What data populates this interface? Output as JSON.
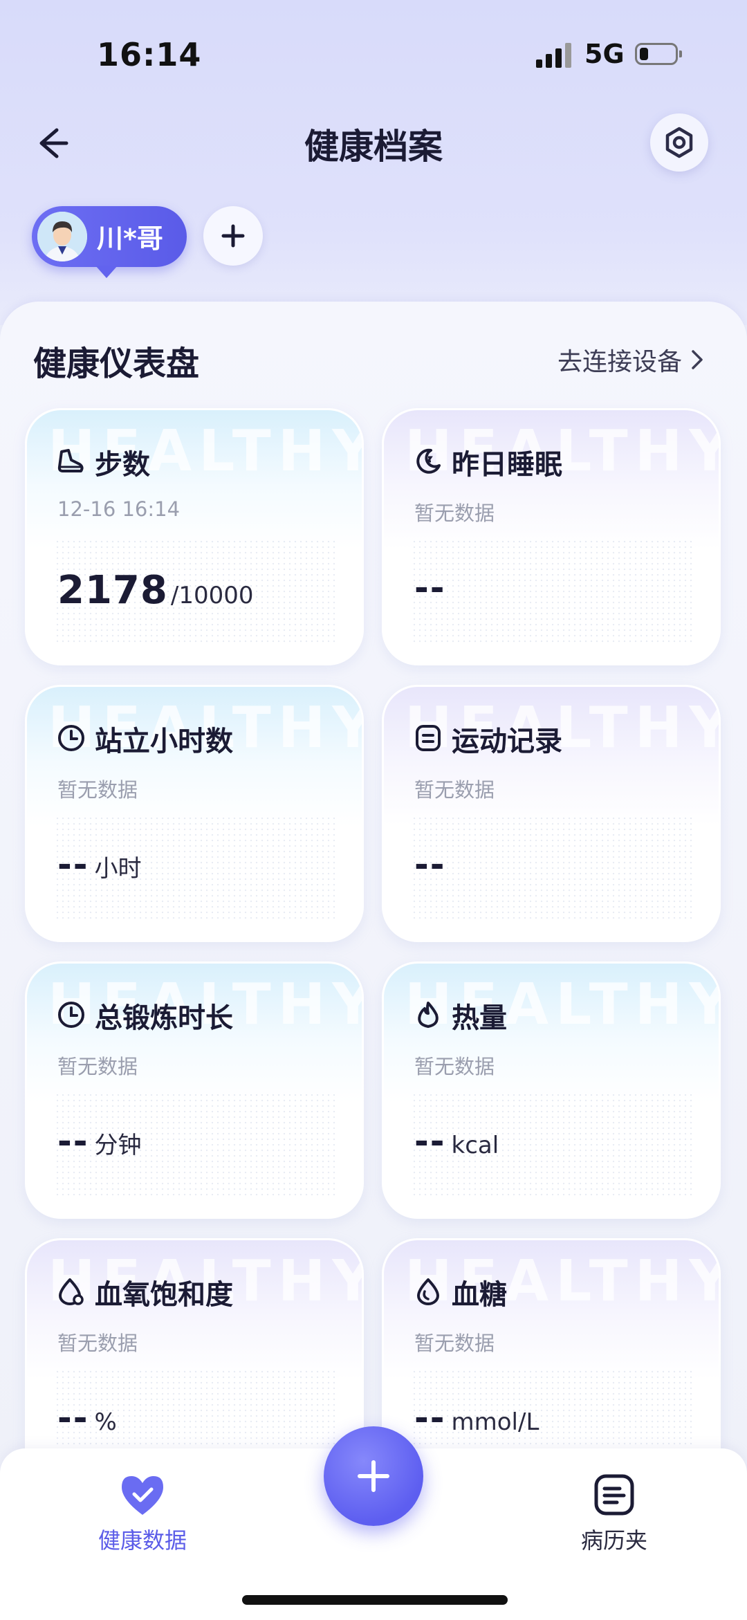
{
  "status_bar": {
    "time": "16:14",
    "network": "5G"
  },
  "header": {
    "title": "健康档案"
  },
  "profile": {
    "name": "川*哥"
  },
  "dashboard": {
    "title": "健康仪表盘",
    "connect_label": "去连接设备",
    "watermark": "HEALTHY",
    "cards": [
      {
        "title": "步数",
        "subtitle": "12-16 16:14",
        "value": "2178",
        "goal": "/10000",
        "icon": "shoe-icon"
      },
      {
        "title": "昨日睡眠",
        "subtitle": "暂无数据",
        "value": "--",
        "icon": "moon-icon"
      },
      {
        "title": "站立小时数",
        "subtitle": "暂无数据",
        "value": "--",
        "unit": "小时",
        "icon": "clock-icon"
      },
      {
        "title": "运动记录",
        "subtitle": "暂无数据",
        "value": "--",
        "icon": "note-icon"
      },
      {
        "title": "总锻炼时长",
        "subtitle": "暂无数据",
        "value": "--",
        "unit": "分钟",
        "icon": "clock-icon"
      },
      {
        "title": "热量",
        "subtitle": "暂无数据",
        "value": "--",
        "unit": "kcal",
        "icon": "flame-icon"
      },
      {
        "title": "血氧饱和度",
        "subtitle": "暂无数据",
        "value": "--",
        "unit": "%",
        "icon": "drop-icon"
      },
      {
        "title": "血糖",
        "subtitle": "暂无数据",
        "value": "--",
        "unit": "mmol/L",
        "icon": "glucose-drop-icon"
      }
    ]
  },
  "bottom_nav": {
    "items": [
      {
        "label": "健康数据",
        "icon": "heart-check-icon",
        "active": true
      },
      {
        "label": "病历夹",
        "icon": "folder-doc-icon",
        "active": false
      }
    ]
  },
  "colors": {
    "accent": "#5f60ef",
    "active_label": "#5b5ce8",
    "inactive_label": "#2a2a40"
  }
}
